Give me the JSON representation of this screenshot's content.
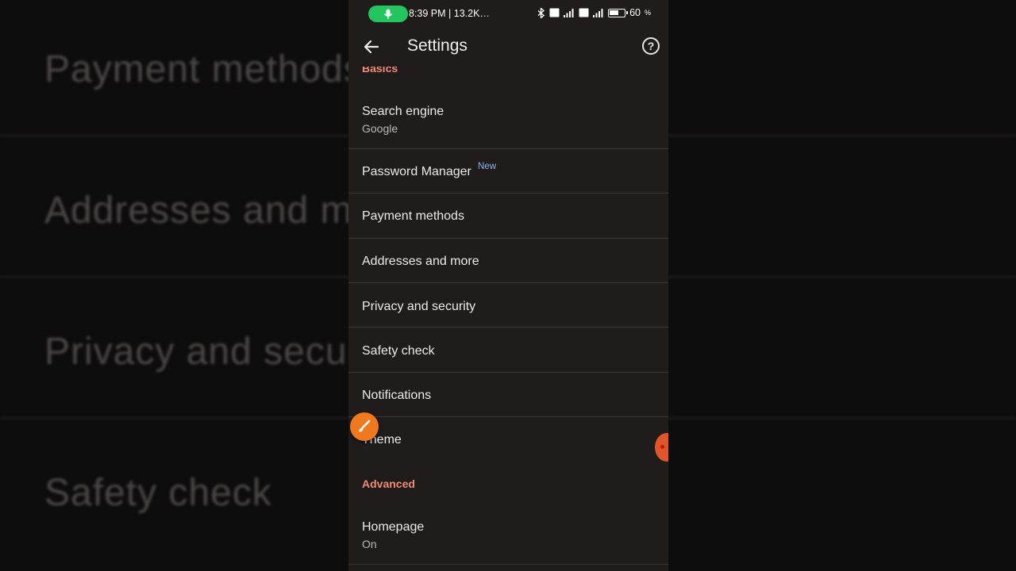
{
  "background": {
    "rows": [
      "Payment methods",
      "Addresses and more",
      "Privacy and security",
      "Safety check"
    ]
  },
  "status_bar": {
    "time_info": "8:39 PM | 13.2K…",
    "battery": "60"
  },
  "app_bar": {
    "title": "Settings",
    "help_glyph": "?"
  },
  "sections": {
    "basics": "Basics",
    "advanced": "Advanced"
  },
  "items": [
    {
      "title": "Search engine",
      "subtitle": "Google"
    },
    {
      "title": "Password Manager",
      "badge": "New"
    },
    {
      "title": "Payment methods"
    },
    {
      "title": "Addresses and more"
    },
    {
      "title": "Privacy and security"
    },
    {
      "title": "Safety check"
    },
    {
      "title": "Notifications"
    },
    {
      "title": "Theme"
    },
    {
      "title": "Homepage",
      "subtitle": "On"
    }
  ],
  "colors": {
    "accent": "#f28b71",
    "badge": "#8ab4f8",
    "background": "#1f1c1b",
    "mic_pill": "#22c55e",
    "fab": "#f0781e"
  },
  "icons": [
    "back-arrow-icon",
    "help-icon",
    "microphone-icon",
    "bluetooth-icon",
    "signal-icon",
    "battery-icon",
    "paintbrush-icon"
  ]
}
